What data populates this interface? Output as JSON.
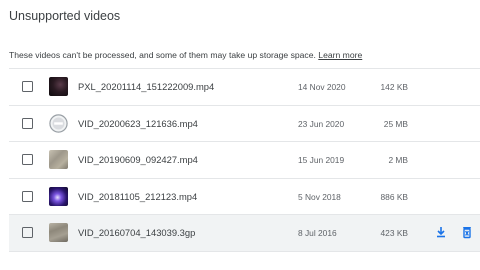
{
  "page": {
    "title": "Unsupported videos",
    "description": "These videos can't be processed, and some of them may take up storage space.",
    "learn_more": "Learn more"
  },
  "colors": {
    "accent": "#1a73e8",
    "text": "#3c4043",
    "secondary_text": "#5f6368",
    "divider": "#e4e6e8",
    "hover_row": "#f1f3f4"
  },
  "rows": [
    {
      "name": "PXL_20201114_151222009.mp4",
      "date": "14 Nov 2020",
      "size": "142 KB",
      "thumbnail": "dark-video-thumbnail"
    },
    {
      "name": "VID_20200623_121636.mp4",
      "date": "23 Jun 2020",
      "size": "25 MB",
      "thumbnail": "blocked-circle-icon"
    },
    {
      "name": "VID_20190609_092427.mp4",
      "date": "15 Jun 2019",
      "size": "2 MB",
      "thumbnail": "stone-texture-thumbnail"
    },
    {
      "name": "VID_20181105_212123.mp4",
      "date": "5 Nov 2018",
      "size": "886 KB",
      "thumbnail": "purple-light-thumbnail"
    },
    {
      "name": "VID_20160704_143039.3gp",
      "date": "8 Jul 2016",
      "size": "423 KB",
      "thumbnail": "wall-texture-thumbnail"
    }
  ],
  "row_actions": {
    "download_icon": "download-icon",
    "delete_icon": "trash-icon"
  }
}
